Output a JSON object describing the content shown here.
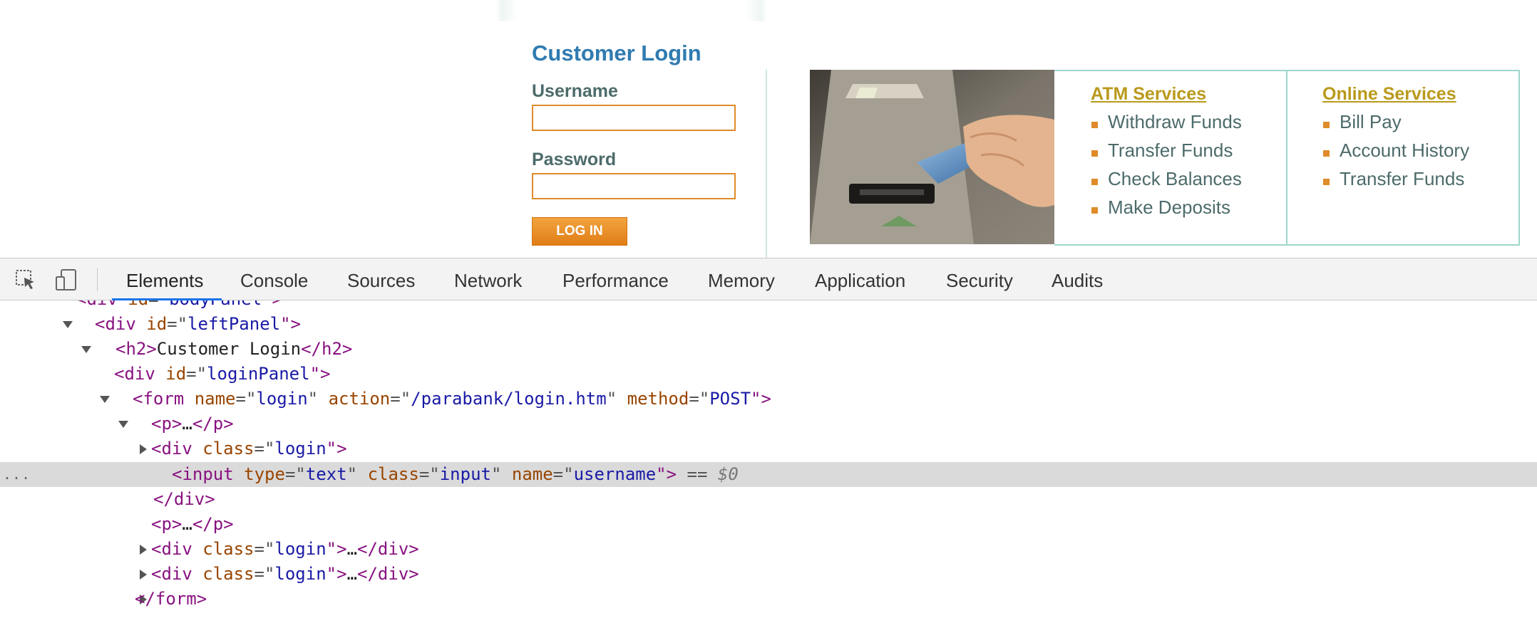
{
  "page": {
    "login_title": "Customer Login",
    "username_label": "Username",
    "password_label": "Password",
    "username_value": "",
    "password_value": "",
    "login_button": "LOG IN",
    "atm_services": {
      "title": "ATM Services",
      "items": [
        "Withdraw Funds",
        "Transfer Funds",
        "Check Balances",
        "Make Deposits"
      ]
    },
    "online_services": {
      "title": "Online Services",
      "items": [
        "Bill Pay",
        "Account History",
        "Transfer Funds"
      ]
    }
  },
  "devtools": {
    "tabs": [
      "Elements",
      "Console",
      "Sources",
      "Network",
      "Performance",
      "Memory",
      "Application",
      "Security",
      "Audits"
    ],
    "active_tab": "Elements",
    "colors": {
      "accent": "#1a73e8",
      "tag": "#881280",
      "attr_name": "#994500",
      "attr_value": "#1a1aa6"
    },
    "tree": {
      "r0": {
        "tag_open": "<div ",
        "a1": "id",
        "eq": "=\"",
        "v1": "bodyPanel",
        "close": "\">"
      },
      "r1": {
        "tag_open": "<div ",
        "a1": "id",
        "eq": "=\"",
        "v1": "leftPanel",
        "close": "\">"
      },
      "r2": {
        "open": "<h2>",
        "text": "Customer Login",
        "close": "</h2>"
      },
      "r3": {
        "tag_open": "<div ",
        "a1": "id",
        "eq": "=\"",
        "v1": "loginPanel",
        "close": "\">"
      },
      "r4": {
        "tag_open": "<form ",
        "a1": "name",
        "v1": "login",
        "a2": "action",
        "v2": "/parabank/login.htm",
        "a3": "method",
        "v3": "POST",
        "close": "\">"
      },
      "r5": {
        "open": "<p>",
        "ellipsis": "…",
        "close": "</p>"
      },
      "r6": {
        "tag_open": "<div ",
        "a1": "class",
        "v1": "login",
        "close": "\">"
      },
      "r7": {
        "tag_open": "<input ",
        "a1": "type",
        "v1": "text",
        "a2": "class",
        "v2": "input",
        "a3": "name",
        "v3": "username",
        "close": "\">",
        "marker": " == ",
        "var": "$0",
        "dots": "..."
      },
      "r8": {
        "close": "</div>"
      },
      "r9": {
        "open": "<p>",
        "ellipsis": "…",
        "close": "</p>"
      },
      "r10": {
        "tag_open": "<div ",
        "a1": "class",
        "v1": "login",
        "mid": "\">",
        "ellipsis": "…",
        "close": "</div>"
      },
      "r11": {
        "tag_open": "<div ",
        "a1": "class",
        "v1": "login",
        "mid": "\">",
        "ellipsis": "…",
        "close": "</div>"
      },
      "r12": {
        "close": "</form>"
      }
    }
  }
}
